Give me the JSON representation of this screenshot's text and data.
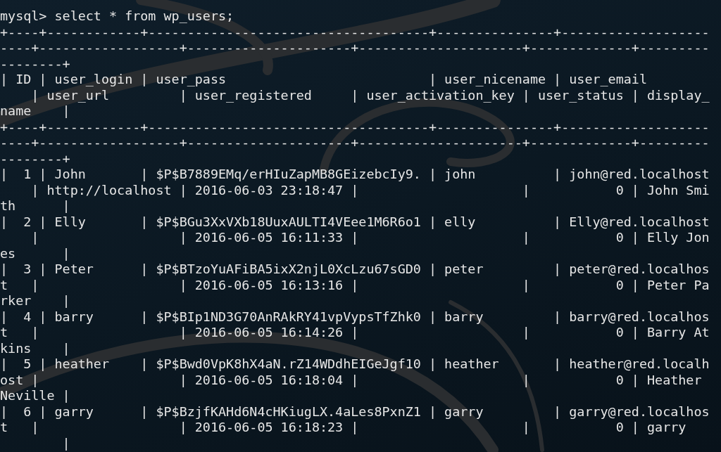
{
  "terminal": {
    "lines": [
      "mysql> select * from wp_users;",
      "+----+------------+------------------------------------+---------------+-------------------",
      "----+------------------+---------------------+---------------------+-------------+---------",
      "--------+",
      "| ID | user_login | user_pass                          | user_nicename | user_email",
      "    | user_url         | user_registered     | user_activation_key | user_status | display_",
      "name    |",
      "+----+------------+------------------------------------+---------------+-------------------",
      "----+------------------+---------------------+---------------------+-------------+---------",
      "--------+",
      "|  1 | John       | $P$B7889EMq/erHIuZapMB8GEizebcIy9. | john          | john@red.localhost",
      "    | http://localhost | 2016-06-03 23:18:47 |                     |           0 | John Smi",
      "th      |",
      "|  2 | Elly       | $P$BGu3XxVXb18UuxAULTI4VEee1M6R6o1 | elly          | Elly@red.localhost",
      "    |                  | 2016-06-05 16:11:33 |                     |           0 | Elly Jon",
      "es      |",
      "|  3 | Peter      | $P$BTzoYuAFiBA5ixX2njL0XcLzu67sGD0 | peter         | peter@red.localhos",
      "t   |                  | 2016-06-05 16:13:16 |                     |           0 | Peter Pa",
      "rker    |",
      "|  4 | barry      | $P$BIp1ND3G70AnRAkRY41vpVypsTfZhk0 | barry         | barry@red.localhos",
      "t   |                  | 2016-06-05 16:14:26 |                     |           0 | Barry At",
      "kins    |",
      "|  5 | heather    | $P$Bwd0VpK8hX4aN.rZ14WDdhEIGeJgf10 | heather       | heather@red.localh",
      "ost |                  | 2016-06-05 16:18:04 |                     |           0 | Heather",
      "Neville |",
      "|  6 | garry      | $P$BzjfKAHd6N4cHKiugLX.4aLes8PxnZ1 | garry         | garry@red.localhos",
      "t   |                  | 2016-06-05 16:18:23 |                     |           0 | garry",
      "        |"
    ]
  }
}
